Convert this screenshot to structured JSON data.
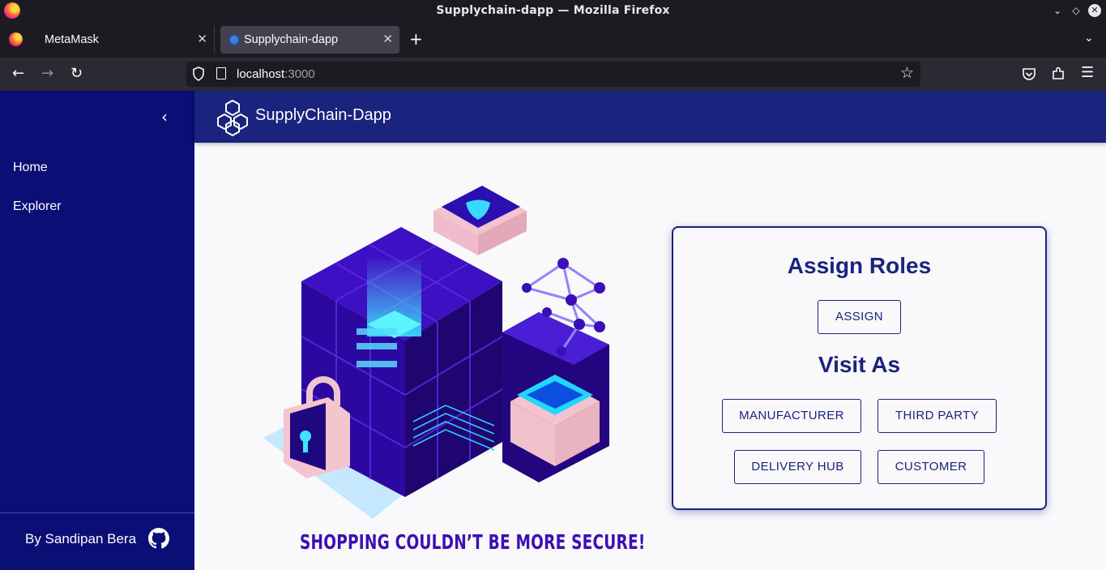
{
  "browser": {
    "window_title": "Supplychain-dapp — Mozilla Firefox",
    "tabs": [
      {
        "label": "MetaMask",
        "active": false
      },
      {
        "label": "Supplychain-dapp",
        "active": true
      }
    ],
    "url_host": "localhost",
    "url_port": ":3000"
  },
  "sidebar": {
    "items": [
      {
        "label": "Home"
      },
      {
        "label": "Explorer"
      }
    ],
    "footer_text": "By Sandipan Bera"
  },
  "appbar": {
    "title": "SupplyChain-Dapp"
  },
  "hero": {
    "slogan": "SHOPPING COULDN’T BE MORE SECURE!"
  },
  "roles_card": {
    "assign_title": "Assign Roles",
    "assign_button": "ASSIGN",
    "visit_title": "Visit As",
    "visit_buttons": [
      {
        "label": "MANUFACTURER"
      },
      {
        "label": "THIRD PARTY"
      },
      {
        "label": "DELIVERY HUB"
      },
      {
        "label": "CUSTOMER"
      }
    ]
  },
  "colors": {
    "sidebar_bg": "#0a0e75",
    "appbar_bg": "#1a237e",
    "accent_text": "#1a237e",
    "slogan": "#3b0fb5"
  }
}
